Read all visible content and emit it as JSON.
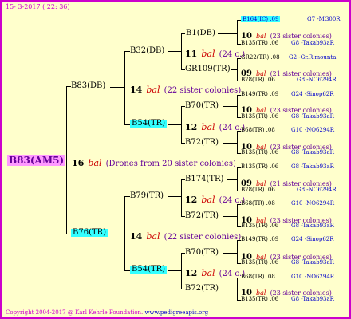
{
  "header": {
    "date": "15- 3-2017 ( 22: 36)"
  },
  "root": {
    "name": "B83(AM5)",
    "num": "16",
    "bal": "bal",
    "note": "(Drones from 20 sister colonies)"
  },
  "sire": {
    "name": "B83(DB)",
    "num": "14",
    "bal": "bal",
    "note": "(22 sister colonies)"
  },
  "dam": {
    "name": "B76(TR)",
    "num": "14",
    "bal": "bal",
    "note": "(22 sister colonies)"
  },
  "ss": {
    "name": "B32(DB)",
    "num": "11",
    "bal": "bal",
    "note": "(24 c.)"
  },
  "sd": {
    "name": "B54(TR)",
    "num": "12",
    "bal": "bal",
    "note": "(24 c.)"
  },
  "ds": {
    "name": "B79(TR)",
    "num": "12",
    "bal": "bal",
    "note": "(24 c.)"
  },
  "dd": {
    "name": "B54(TR)",
    "num": "12",
    "bal": "bal",
    "note": "(24 c.)"
  },
  "g3": [
    {
      "name": "B1(DB)",
      "num": "10",
      "bal": "bal",
      "note": "(23 sister colonies)"
    },
    {
      "name": "GR109(TR)",
      "num": "09",
      "bal": "bal",
      "note": "(21 sister colonies)"
    },
    {
      "name": "B70(TR)",
      "num": "10",
      "bal": "bal",
      "note": "(23 sister colonies)"
    },
    {
      "name": "B72(TR)",
      "num": "10",
      "bal": "bal",
      "note": "(23 sister colonies)"
    },
    {
      "name": "B174(TR)",
      "num": "09",
      "bal": "bal",
      "note": "(21 sister colonies)"
    },
    {
      "name": "B72(TR)",
      "num": "10",
      "bal": "bal",
      "note": "(23 sister colonies)"
    },
    {
      "name": "B70(TR)",
      "num": "10",
      "bal": "bal",
      "note": "(23 sister colonies)"
    },
    {
      "name": "B72(TR)",
      "num": "10",
      "bal": "bal",
      "note": "(23 sister colonies)"
    }
  ],
  "g4": [
    {
      "text": "B164(IC) .09",
      "code": "G7 -MG00R"
    },
    {
      "text": "B135(TR) .06",
      "code": "G8 -Takab93aR"
    },
    {
      "text": "GR22(TR) .08",
      "code": "G2 -Gr.R.mounta"
    },
    {
      "text": "B78(TR) .06",
      "code": "G8 -NO6294R"
    },
    {
      "text": "B149(TR) .09",
      "code": "G24 -Sinop62R"
    },
    {
      "text": "B135(TR) .06",
      "code": "G8 -Takab93aR"
    },
    {
      "text": "B68(TR) .08",
      "code": "G10 -NO6294R"
    },
    {
      "text": "B135(TR) .06",
      "code": "G8 -Takab93aR"
    },
    {
      "text": "B135(TR) .06",
      "code": "G8 -Takab93aR"
    },
    {
      "text": "B78(TR) .06",
      "code": "G8 -NO6294R"
    },
    {
      "text": "B68(TR) .08",
      "code": "G10 -NO6294R"
    },
    {
      "text": "B135(TR) .06",
      "code": "G8 -Takab93aR"
    },
    {
      "text": "B149(TR) .09",
      "code": "G24 -Sinop62R"
    },
    {
      "text": "B135(TR) .06",
      "code": "G8 -Takab93aR"
    },
    {
      "text": "B68(TR) .08",
      "code": "G10 -NO6294R"
    },
    {
      "text": "B135(TR) .06",
      "code": "G8 -Takab93aR"
    }
  ],
  "footer": {
    "copyright": "Copyright 2004-2017 @ Karl Kehrle Foundation.",
    "url": "www.pedigreeapis.org"
  }
}
